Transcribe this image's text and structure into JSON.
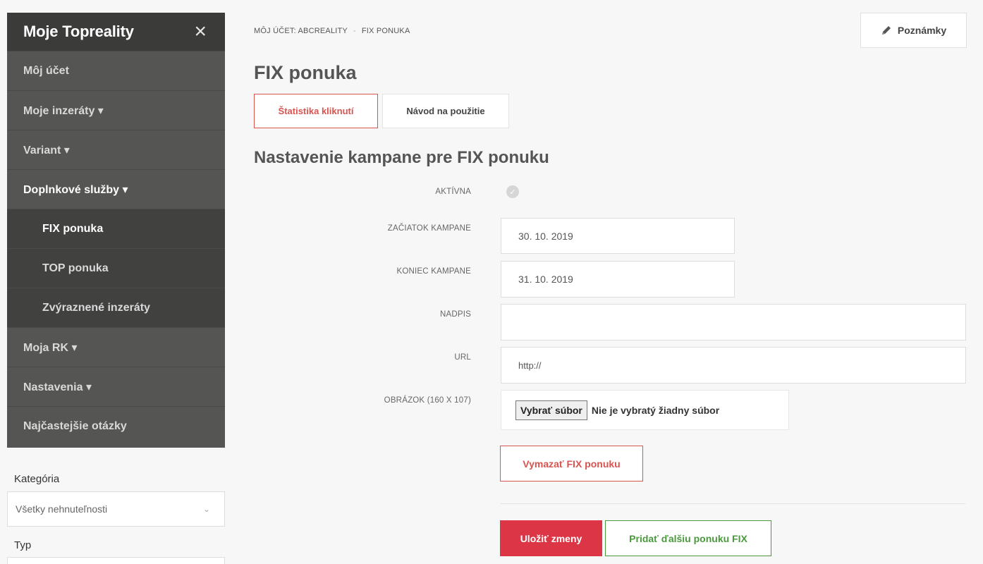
{
  "sidebar": {
    "title": "Moje Topreality",
    "close_icon": "×",
    "items": [
      {
        "label": "Môj účet"
      },
      {
        "label": "Moje inzeráty ▾"
      },
      {
        "label": "Variant ▾"
      },
      {
        "label": "Doplnkové služby ▾"
      },
      {
        "label": "FIX ponuka"
      },
      {
        "label": "TOP ponuka"
      },
      {
        "label": "Zvýraznené inzeráty"
      },
      {
        "label": "Moja RK ▾"
      },
      {
        "label": "Nastavenia ▾"
      },
      {
        "label": "Najčastejšie otázky"
      }
    ]
  },
  "filters": {
    "category_label": "Kategória",
    "category_value": "Všetky nehnuteľnosti",
    "type_label": "Typ"
  },
  "breadcrumb": {
    "account": "MÔJ ÚČET: ABCREALITY",
    "separator": "-",
    "current": "FIX PONUKA"
  },
  "header": {
    "notes_label": "Poznámky",
    "notes_icon": "pencil-icon"
  },
  "page": {
    "title": "FIX ponuka",
    "tab_stats": "Štatistika kliknutí",
    "tab_guide": "Návod na použitie",
    "section_title": "Nastavenie kampane pre FIX ponuku"
  },
  "form": {
    "active_label": "AKTÍVNA",
    "active_icon": "check-icon",
    "start_label": "ZAČIATOK KAMPANE",
    "start_value": "30. 10. 2019",
    "end_label": "KONIEC KAMPANE",
    "end_value": "31. 10. 2019",
    "heading_label": "NADPIS",
    "heading_value": "",
    "url_label": "URL",
    "url_value": "http://",
    "image_label": "OBRÁZOK (160 X 107)",
    "file_button": "Vybrať súbor",
    "file_status": "Nie je vybratý žiadny súbor"
  },
  "actions": {
    "delete_label": "Vymazať FIX ponuku",
    "save_label": "Uložiť zmeny",
    "add_label": "Pridať ďalšiu ponuku FIX"
  },
  "colors": {
    "accent_red": "#dc3545",
    "accent_green": "#4a9a3d",
    "sidebar_bg": "#555553"
  }
}
